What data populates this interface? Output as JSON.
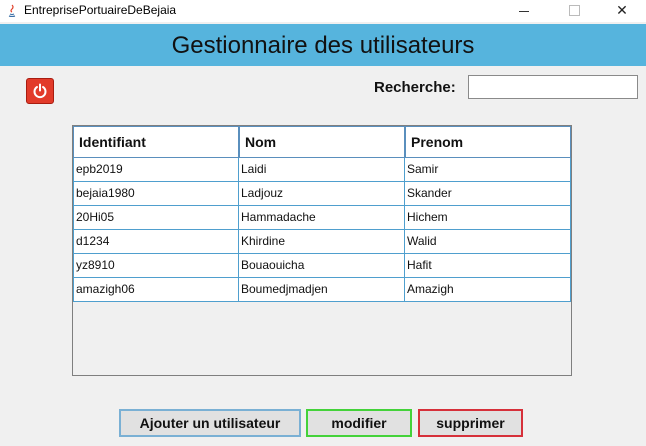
{
  "window": {
    "title": "EntreprisePortuaireDeBejaia",
    "minimize_icon": "minimize-icon",
    "maximize_icon": "maximize-icon",
    "close_icon": "close-icon",
    "close_label": "✕"
  },
  "header": {
    "title": "Gestionnaire des utilisateurs",
    "color": "#56b4dd"
  },
  "power_button": {
    "icon": "power-icon",
    "color": "#e23b2a"
  },
  "search": {
    "label": "Recherche:",
    "value": "",
    "placeholder": ""
  },
  "table": {
    "columns": [
      "Identifiant",
      "Nom",
      "Prenom"
    ],
    "rows": [
      [
        "epb2019",
        "Laidi",
        "Samir"
      ],
      [
        "bejaia1980",
        "Ladjouz",
        "Skander"
      ],
      [
        "20Hi05",
        "Hammadache",
        "Hichem"
      ],
      [
        "d1234",
        "Khirdine",
        "Walid"
      ],
      [
        "yz8910",
        "Bouaouicha",
        "Hafit"
      ],
      [
        "amazigh06",
        "Boumedjmadjen",
        "Amazigh"
      ]
    ]
  },
  "buttons": {
    "add": "Ajouter un utilisateur",
    "modify": "modifier",
    "delete": "supprimer"
  }
}
